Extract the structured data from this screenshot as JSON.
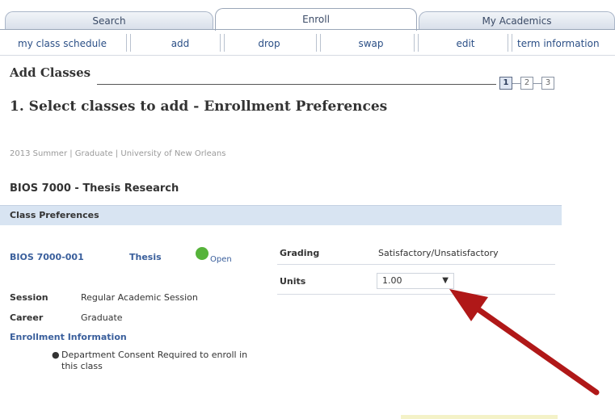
{
  "tabs": {
    "search": "Search",
    "enroll": "Enroll",
    "my_academics": "My Academics"
  },
  "subtabs": {
    "schedule": "my class schedule",
    "add": "add",
    "drop": "drop",
    "swap": "swap",
    "edit": "edit",
    "term_info": "term information"
  },
  "heading": "Add Classes",
  "steps": [
    "1",
    "2",
    "3"
  ],
  "step_title": "1.  Select classes to add - Enrollment Preferences",
  "term_line": "2013 Summer | Graduate | University of New Orleans",
  "course_title": "BIOS 7000 - Thesis Research",
  "preferences_bar": "Class Preferences",
  "section": {
    "id": "BIOS 7000-001",
    "component": "Thesis",
    "status": "Open"
  },
  "details": {
    "session_label": "Session",
    "session_value": "Regular Academic Session",
    "career_label": "Career",
    "career_value": "Graduate",
    "enrollment_info_label": "Enrollment Information",
    "enrollment_note": "Department Consent Required to enroll in this class"
  },
  "grading": {
    "grading_label": "Grading",
    "grading_value": "Satisfactory/Unsatisfactory",
    "units_label": "Units",
    "units_value": "1.00"
  },
  "colors": {
    "annotation_arrow": "#b01818",
    "open_status": "#56b33a"
  }
}
